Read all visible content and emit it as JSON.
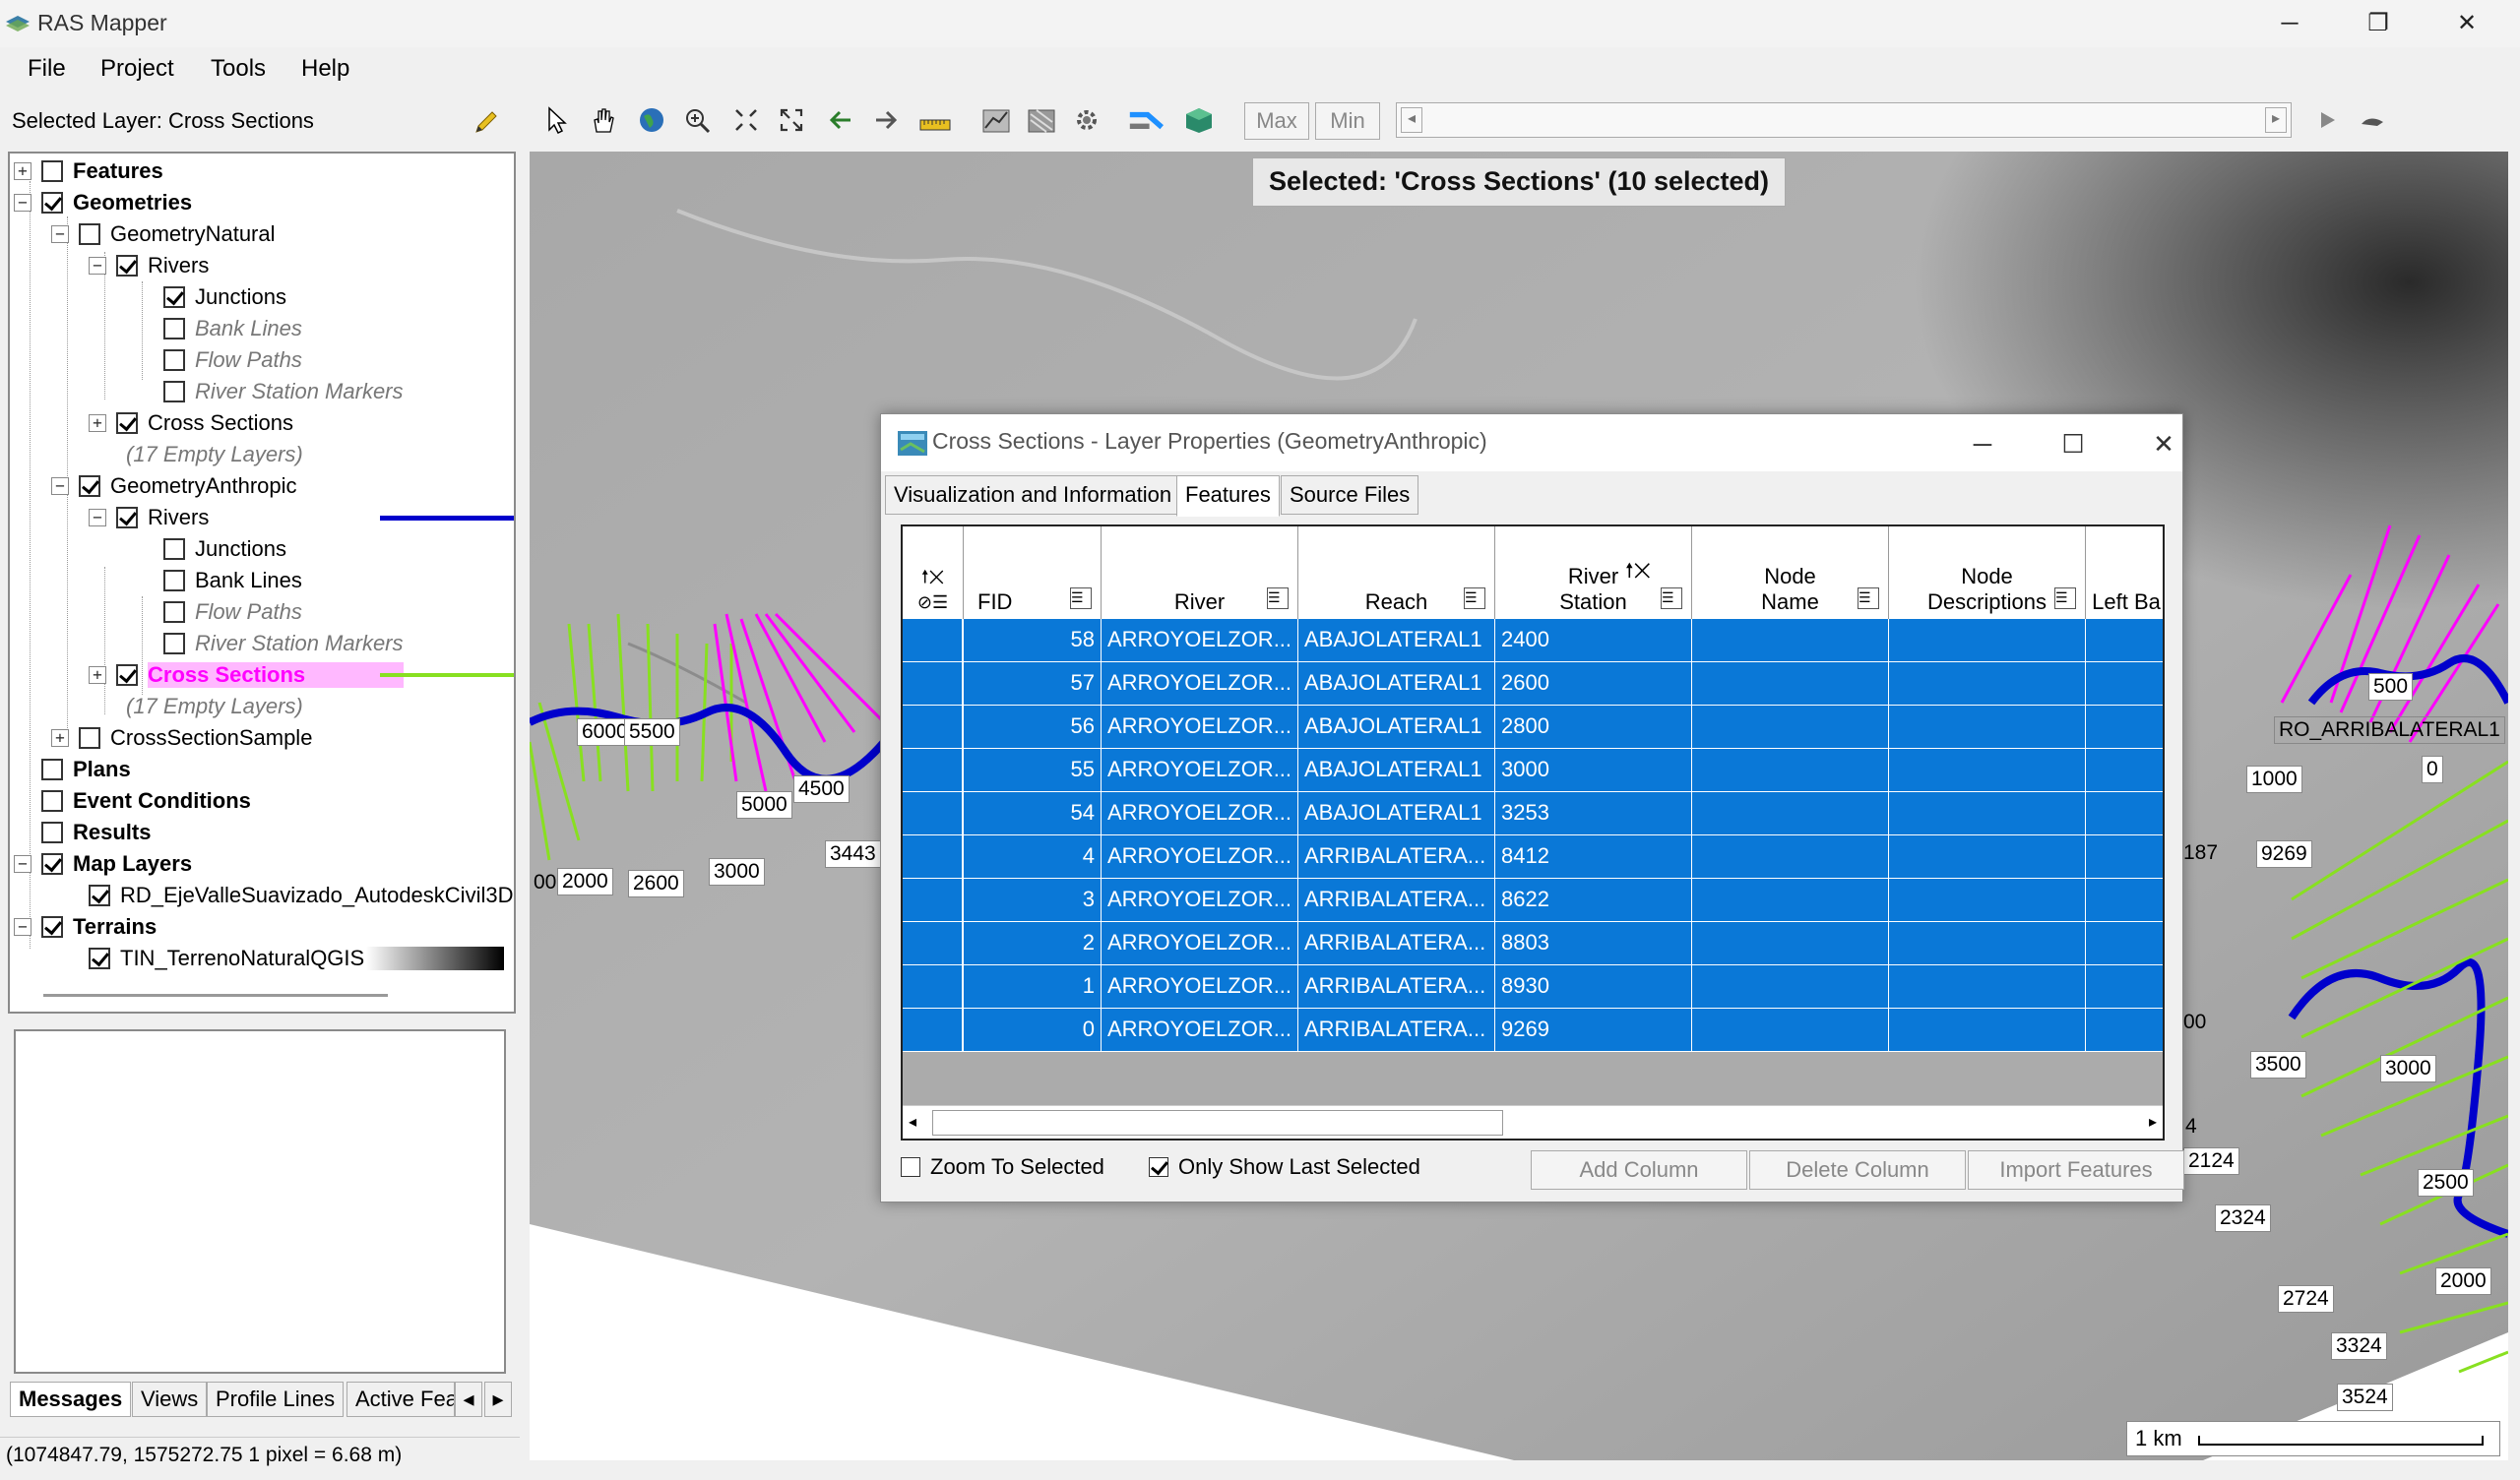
{
  "window": {
    "title": "RAS Mapper",
    "minimize": "─",
    "maximize": "❐",
    "close": "✕"
  },
  "menu": [
    "File",
    "Project",
    "Tools",
    "Help"
  ],
  "layer_header": "Selected Layer: Cross Sections",
  "tree": {
    "features": "Features",
    "geometries": "Geometries",
    "geometry_natural": "GeometryNatural",
    "rivers_nat": "Rivers",
    "junctions_nat": "Junctions",
    "bank_lines_nat": "Bank Lines",
    "flow_paths_nat": "Flow Paths",
    "rsm_nat": "River Station Markers",
    "xs_nat": "Cross Sections",
    "empty_nat": "(17 Empty Layers)",
    "geometry_anthropic": "GeometryAnthropic",
    "rivers_anth": "Rivers",
    "junctions_anth": "Junctions",
    "bank_lines_anth": "Bank Lines",
    "flow_paths_anth": "Flow Paths",
    "rsm_anth": "River Station Markers",
    "xs_anth": "Cross Sections",
    "empty_anth": "(17 Empty Layers)",
    "xs_sample": "CrossSectionSample",
    "plans": "Plans",
    "event_conditions": "Event Conditions",
    "results": "Results",
    "map_layers": "Map Layers",
    "map_layer_1": "RD_EjeValleSuavizado_AutodeskCivil3D",
    "terrains": "Terrains",
    "terrain_1": "TIN_TerrenoNaturalQGIS"
  },
  "bottom_tabs": [
    "Messages",
    "Views",
    "Profile Lines",
    "Active Fea"
  ],
  "status": "(1074847.79, 1575272.75  1 pixel = 6.68 m)",
  "toolbar": {
    "max": "Max",
    "min": "Min"
  },
  "map": {
    "banner": "Selected: 'Cross Sections' (10 selected)",
    "scale": "1 km",
    "labels_left": [
      "6000",
      "5500",
      "5000",
      "4500",
      "3443",
      "2000",
      "2600",
      "3000",
      "00"
    ],
    "labels_right": [
      "500",
      "RO_ARRIBALATERAL1",
      "1000",
      "0",
      "187",
      "9269",
      "00",
      "3500",
      "3000",
      "4",
      "2124",
      "2500",
      "2324",
      "2000",
      "2724",
      "3324",
      "3524"
    ]
  },
  "dialog": {
    "title": "Cross Sections - Layer Properties (GeometryAnthropic)",
    "tabs": [
      "Visualization and Information",
      "Features",
      "Source Files"
    ],
    "columns": {
      "fid": "FID",
      "river": "River",
      "reach": "Reach",
      "river_station": [
        "River",
        "Station"
      ],
      "node_name": [
        "Node",
        "Name"
      ],
      "node_desc": [
        "Node",
        "Descriptions"
      ],
      "left_bank": "Left Ba"
    },
    "rows": [
      {
        "fid": "58",
        "river": "ARROYOELZOR...",
        "reach": "ABAJOLATERAL1",
        "station": "2400"
      },
      {
        "fid": "57",
        "river": "ARROYOELZOR...",
        "reach": "ABAJOLATERAL1",
        "station": "2600"
      },
      {
        "fid": "56",
        "river": "ARROYOELZOR...",
        "reach": "ABAJOLATERAL1",
        "station": "2800"
      },
      {
        "fid": "55",
        "river": "ARROYOELZOR...",
        "reach": "ABAJOLATERAL1",
        "station": "3000"
      },
      {
        "fid": "54",
        "river": "ARROYOELZOR...",
        "reach": "ABAJOLATERAL1",
        "station": "3253"
      },
      {
        "fid": "4",
        "river": "ARROYOELZOR...",
        "reach": "ARRIBALATERA...",
        "station": "8412"
      },
      {
        "fid": "3",
        "river": "ARROYOELZOR...",
        "reach": "ARRIBALATERA...",
        "station": "8622"
      },
      {
        "fid": "2",
        "river": "ARROYOELZOR...",
        "reach": "ARRIBALATERA...",
        "station": "8803"
      },
      {
        "fid": "1",
        "river": "ARROYOELZOR...",
        "reach": "ARRIBALATERA...",
        "station": "8930"
      },
      {
        "fid": "0",
        "river": "ARROYOELZOR...",
        "reach": "ARRIBALATERA...",
        "station": "9269"
      }
    ],
    "zoom_to_selected": "Zoom To Selected",
    "only_show_last": "Only Show Last Selected",
    "add_column": "Add Column",
    "delete_column": "Delete Column",
    "import_features": "Import Features"
  },
  "colors": {
    "selection": "#0a78d7",
    "river": "#0000cc",
    "xs_natural": "#88e020",
    "xs_selected": "#ff00ff",
    "highlight": "#ffb8ff"
  }
}
